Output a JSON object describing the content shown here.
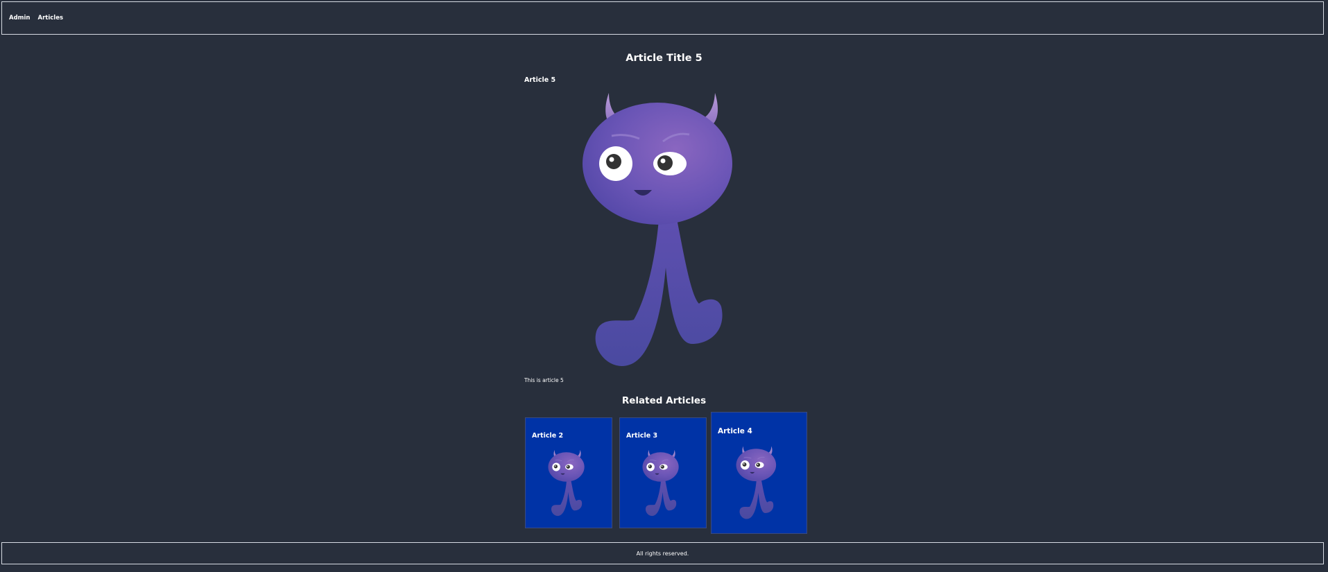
{
  "nav": {
    "items": [
      {
        "label": "Admin"
      },
      {
        "label": "Articles"
      }
    ]
  },
  "article": {
    "title": "Article Title 5",
    "subtitle": "Article 5",
    "body": "This is article 5",
    "image_icon": "purple-horned-monster"
  },
  "related": {
    "heading": "Related Articles",
    "cards": [
      {
        "title": "Article 2"
      },
      {
        "title": "Article 3"
      },
      {
        "title": "Article 4"
      }
    ]
  },
  "footer": {
    "text": "All rights reserved."
  },
  "colors": {
    "background": "#282f3c",
    "card": "#0033a6",
    "monster": "#5e4fb0"
  }
}
